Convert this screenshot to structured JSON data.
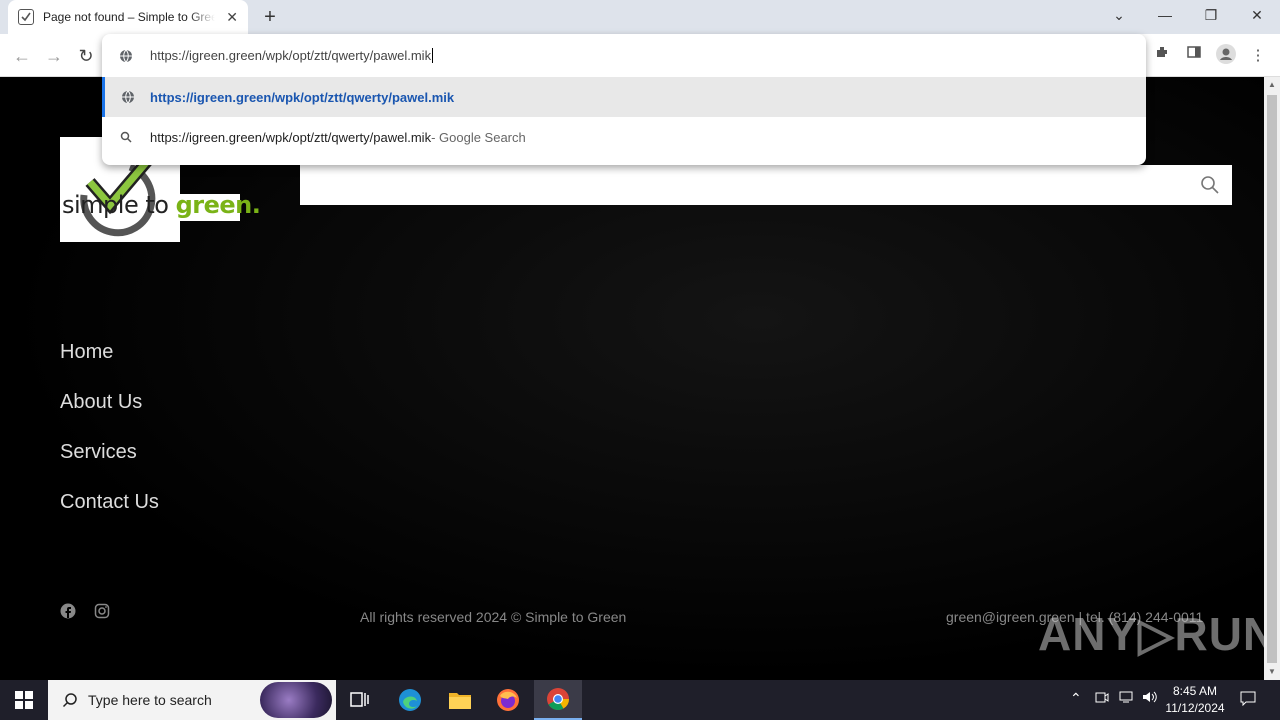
{
  "browser": {
    "tab_title": "Page not found – Simple to Green",
    "url_input": "https://igreen.green/wpk/opt/ztt/qwerty/pawel.mik",
    "suggestions": [
      {
        "text": "https://igreen.green/wpk/opt/ztt/qwerty/pawel.mik",
        "suffix": ""
      },
      {
        "text": "https://igreen.green/wpk/opt/ztt/qwerty/pawel.mik",
        "suffix": " - Google Search"
      }
    ]
  },
  "site": {
    "logo_text_black": "simple to ",
    "logo_text_green": "green.",
    "nav": [
      "Home",
      "About Us",
      "Services",
      "Contact Us"
    ],
    "footer_copy": "All rights reserved 2024 © Simple to Green",
    "footer_contact": "green@igreen.green | tel. (814) 244-0011",
    "watermark": "ANY▷RUN"
  },
  "taskbar": {
    "search_placeholder": "Type here to search",
    "time": "8:45 AM",
    "date": "11/12/2024"
  }
}
